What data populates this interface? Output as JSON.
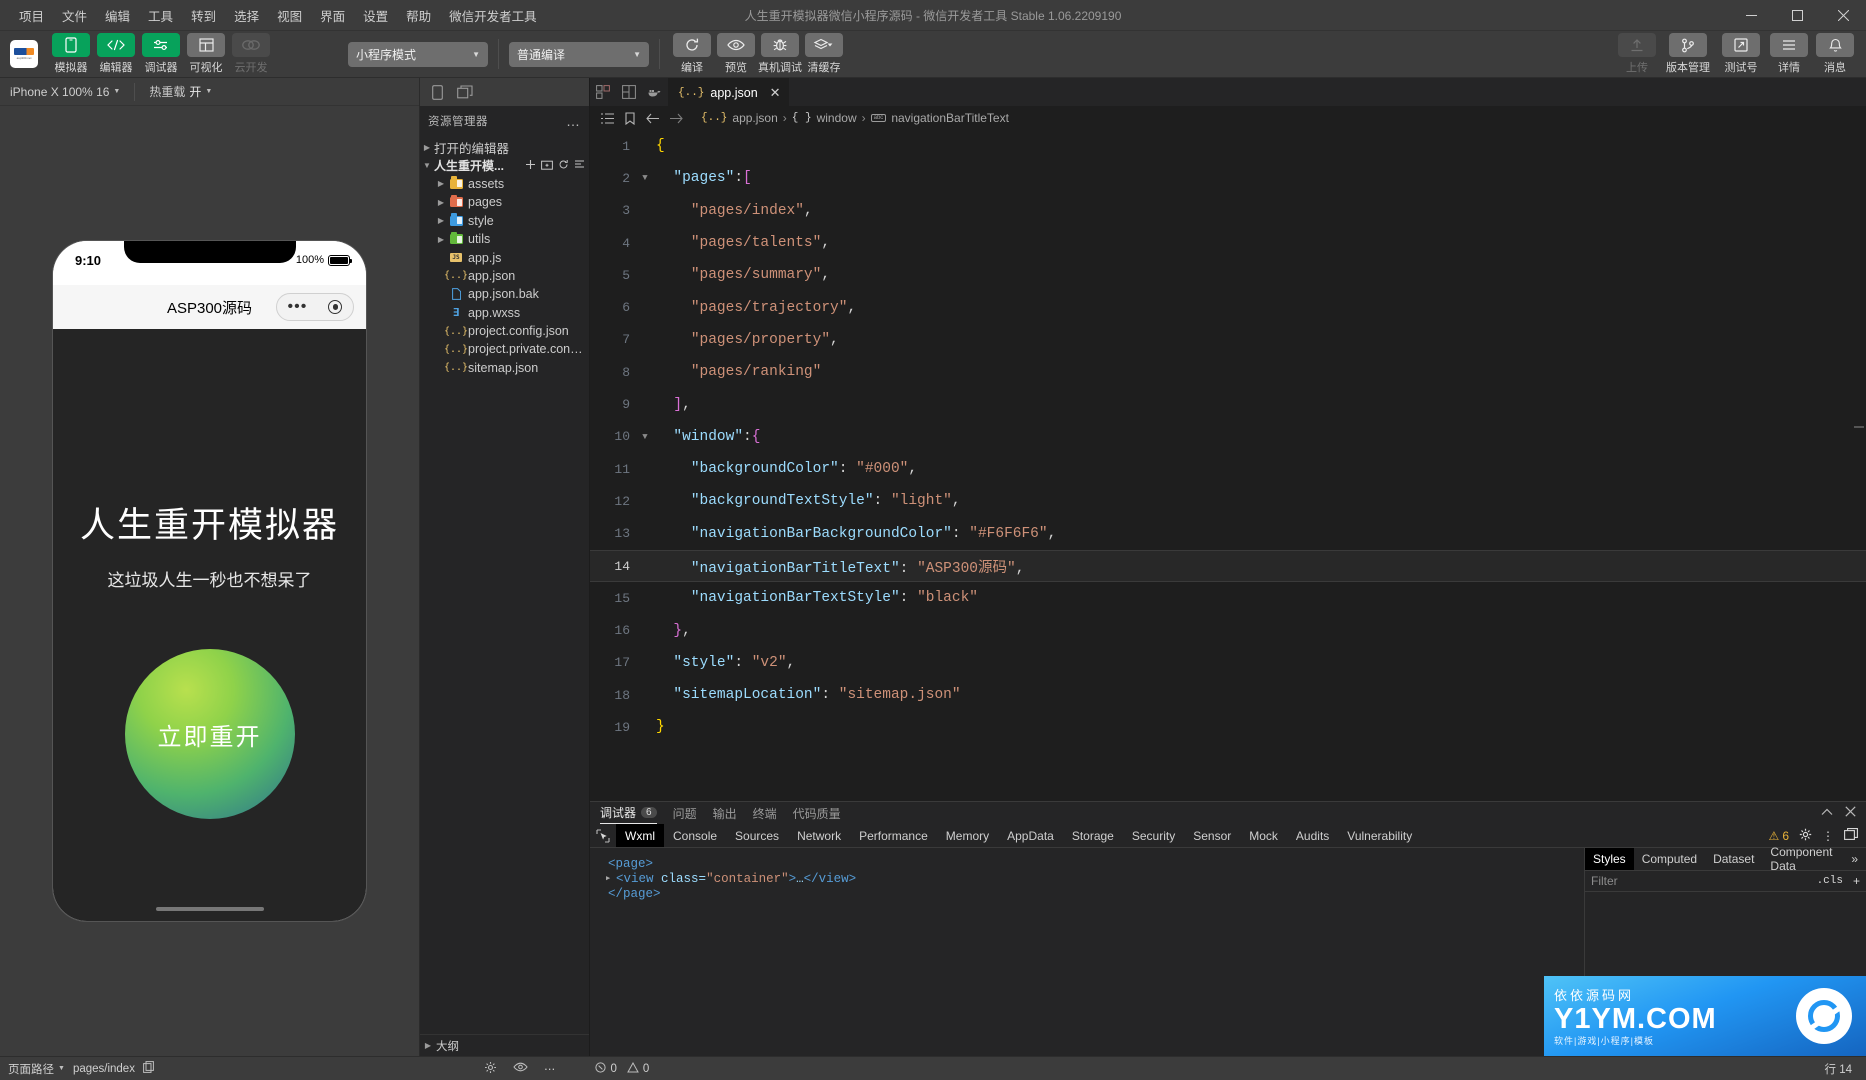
{
  "titlebar": {
    "menus": [
      "项目",
      "文件",
      "编辑",
      "工具",
      "转到",
      "选择",
      "视图",
      "界面",
      "设置",
      "帮助",
      "微信开发者工具"
    ],
    "window_title": "人生重开模拟器微信小程序源码  -  微信开发者工具 Stable 1.06.2209190"
  },
  "toolbar": {
    "left_buttons": [
      {
        "label": "模拟器",
        "icon": "phone-icon",
        "state": "active"
      },
      {
        "label": "编辑器",
        "icon": "code-icon",
        "state": "active"
      },
      {
        "label": "调试器",
        "icon": "sliders-icon",
        "state": "active"
      },
      {
        "label": "可视化",
        "icon": "layout-icon",
        "state": "grey"
      },
      {
        "label": "云开发",
        "icon": "cloud-icon",
        "state": "disabled"
      }
    ],
    "mode_select": "小程序模式",
    "compile_select": "普通编译",
    "mid_buttons": [
      {
        "label": "编译",
        "icon": "refresh-icon"
      },
      {
        "label": "预览",
        "icon": "eye-icon"
      },
      {
        "label": "真机调试",
        "icon": "bug-icon"
      },
      {
        "label": "清缓存",
        "icon": "layers-icon"
      }
    ],
    "right_buttons": [
      {
        "label": "上传",
        "icon": "upload-icon",
        "state": "disabled"
      },
      {
        "label": "版本管理",
        "icon": "git-branch-icon",
        "state": "normal"
      },
      {
        "label": "测试号",
        "icon": "external-link-icon",
        "state": "normal"
      },
      {
        "label": "详情",
        "icon": "menu-icon",
        "state": "normal"
      },
      {
        "label": "消息",
        "icon": "bell-icon",
        "state": "normal"
      }
    ]
  },
  "simulator": {
    "device_select": "iPhone X 100% 16",
    "hot_reload_label": "热重载",
    "hot_reload_value": "开",
    "phone": {
      "status_time": "9:10",
      "battery_text": "100%",
      "nav_title": "ASP300源码",
      "page_title": "人生重开模拟器",
      "page_subtitle": "这垃圾人生一秒也不想呆了",
      "button_label": "立即重开"
    }
  },
  "explorer": {
    "header": "资源管理器",
    "section_open_editors": "打开的编辑器",
    "project_root": "人生重开模...",
    "outline": "大纲",
    "files": [
      {
        "name": "assets",
        "type": "folder",
        "color": "#e8b339",
        "expandable": true,
        "indent": 1
      },
      {
        "name": "pages",
        "type": "folder",
        "color": "#e06c4b",
        "expandable": true,
        "indent": 1
      },
      {
        "name": "style",
        "type": "folder",
        "color": "#3d9ae0",
        "expandable": true,
        "indent": 1
      },
      {
        "name": "utils",
        "type": "folder",
        "color": "#62b83a",
        "expandable": true,
        "indent": 1
      },
      {
        "name": "app.js",
        "type": "js",
        "color": "#e8c26b",
        "expandable": false,
        "indent": 1
      },
      {
        "name": "app.json",
        "type": "json",
        "color": "#e8c26b",
        "expandable": false,
        "indent": 1
      },
      {
        "name": "app.json.bak",
        "type": "file",
        "color": "#4fa3e3",
        "expandable": false,
        "indent": 1
      },
      {
        "name": "app.wxss",
        "type": "wxss",
        "color": "#4fa3e3",
        "expandable": false,
        "indent": 1
      },
      {
        "name": "project.config.json",
        "type": "json",
        "color": "#e8c26b",
        "expandable": false,
        "indent": 1
      },
      {
        "name": "project.private.config.js...",
        "type": "json",
        "color": "#e8c26b",
        "expandable": false,
        "indent": 1
      },
      {
        "name": "sitemap.json",
        "type": "json",
        "color": "#e8c26b",
        "expandable": false,
        "indent": 1
      }
    ]
  },
  "editor": {
    "tab_label": "app.json",
    "breadcrumb": [
      "app.json",
      "window",
      "navigationBarTitleText"
    ],
    "lines": [
      {
        "n": 1,
        "fold": "",
        "html": "<span class=\"k-brace-y\">{</span>"
      },
      {
        "n": 2,
        "fold": "v",
        "html": "  <span class=\"k-key\">\"pages\"</span><span class=\"k-pun\">:</span><span class=\"k-brace-p\">[</span>"
      },
      {
        "n": 3,
        "fold": "",
        "html": "    <span class=\"k-str\">\"pages/index\"</span><span class=\"k-pun\">,</span>"
      },
      {
        "n": 4,
        "fold": "",
        "html": "    <span class=\"k-str\">\"pages/talents\"</span><span class=\"k-pun\">,</span>"
      },
      {
        "n": 5,
        "fold": "",
        "html": "    <span class=\"k-str\">\"pages/summary\"</span><span class=\"k-pun\">,</span>"
      },
      {
        "n": 6,
        "fold": "",
        "html": "    <span class=\"k-str\">\"pages/trajectory\"</span><span class=\"k-pun\">,</span>"
      },
      {
        "n": 7,
        "fold": "",
        "html": "    <span class=\"k-str\">\"pages/property\"</span><span class=\"k-pun\">,</span>"
      },
      {
        "n": 8,
        "fold": "",
        "html": "    <span class=\"k-str\">\"pages/ranking\"</span>"
      },
      {
        "n": 9,
        "fold": "",
        "html": "  <span class=\"k-brace-p\">]</span><span class=\"k-pun\">,</span>"
      },
      {
        "n": 10,
        "fold": "v",
        "html": "  <span class=\"k-key\">\"window\"</span><span class=\"k-pun\">:</span><span class=\"k-brace-p\">{</span>"
      },
      {
        "n": 11,
        "fold": "",
        "html": "    <span class=\"k-key\">\"backgroundColor\"</span><span class=\"k-pun\">: </span><span class=\"k-str\">\"#000\"</span><span class=\"k-pun\">,</span>"
      },
      {
        "n": 12,
        "fold": "",
        "html": "    <span class=\"k-key\">\"backgroundTextStyle\"</span><span class=\"k-pun\">: </span><span class=\"k-str\">\"light\"</span><span class=\"k-pun\">,</span>"
      },
      {
        "n": 13,
        "fold": "",
        "html": "    <span class=\"k-key\">\"navigationBarBackgroundColor\"</span><span class=\"k-pun\">: </span><span class=\"k-str\">\"#F6F6F6\"</span><span class=\"k-pun\">,</span>"
      },
      {
        "n": 14,
        "fold": "",
        "html": "    <span class=\"k-key\">\"navigationBarTitleText\"</span><span class=\"k-pun\">: </span><span class=\"k-str\">\"ASP300源码\"</span><span class=\"k-pun\">,</span>",
        "highlight": true
      },
      {
        "n": 15,
        "fold": "",
        "html": "    <span class=\"k-key\">\"navigationBarTextStyle\"</span><span class=\"k-pun\">: </span><span class=\"k-str\">\"black\"</span>"
      },
      {
        "n": 16,
        "fold": "",
        "html": "  <span class=\"k-brace-p\">}</span><span class=\"k-pun\">,</span>"
      },
      {
        "n": 17,
        "fold": "",
        "html": "  <span class=\"k-key\">\"style\"</span><span class=\"k-pun\">: </span><span class=\"k-str\">\"v2\"</span><span class=\"k-pun\">,</span>"
      },
      {
        "n": 18,
        "fold": "",
        "html": "  <span class=\"k-key\">\"sitemapLocation\"</span><span class=\"k-pun\">: </span><span class=\"k-str\">\"sitemap.json\"</span>"
      },
      {
        "n": 19,
        "fold": "",
        "html": "<span class=\"k-brace-y\">}</span>"
      }
    ]
  },
  "debugger": {
    "top_tabs": [
      {
        "label": "调试器",
        "badge": "6",
        "active": true
      },
      {
        "label": "问题",
        "badge": "",
        "active": false
      },
      {
        "label": "输出",
        "badge": "",
        "active": false
      },
      {
        "label": "终端",
        "badge": "",
        "active": false
      },
      {
        "label": "代码质量",
        "badge": "",
        "active": false
      }
    ],
    "devtools_tabs": [
      "Wxml",
      "Console",
      "Sources",
      "Network",
      "Performance",
      "Memory",
      "AppData",
      "Storage",
      "Security",
      "Sensor",
      "Mock",
      "Audits",
      "Vulnerability"
    ],
    "selected_devtools_tab": "Wxml",
    "warning_count": "6",
    "wxml_lines": [
      {
        "indent": 0,
        "html": "<span class=\"tg\">&lt;page&gt;</span>",
        "arrow": false
      },
      {
        "indent": 1,
        "html": "<span class=\"tg\">&lt;view</span> <span class=\"at\">class</span>=<span class=\"va\">\"container\"</span><span class=\"tg\">&gt;</span>…<span class=\"tg\">&lt;/view&gt;</span>",
        "arrow": true
      },
      {
        "indent": 0,
        "html": "<span class=\"tg\">&lt;/page&gt;</span>",
        "arrow": false
      }
    ],
    "style_tabs": [
      "Styles",
      "Computed",
      "Dataset",
      "Component Data"
    ],
    "selected_style_tab": "Styles",
    "filter_placeholder": "Filter",
    "cls_label": ".cls"
  },
  "watermark": {
    "line1": "依依源码网",
    "line2": "Y1YM.COM",
    "line3": "软件|游戏|小程序|模板"
  },
  "statusbar": {
    "page_path_label": "页面路径",
    "page_path_value": "pages/index",
    "error_count": "0",
    "warn_count": "0",
    "cursor_position": "行 14"
  },
  "colors": {
    "accent_green": "#07a25b",
    "editor_bg": "#1e1e1e",
    "chrome_bg": "#3c3c3c",
    "panel_bg": "#252526",
    "nav_bar_color": "#F6F6F6"
  }
}
